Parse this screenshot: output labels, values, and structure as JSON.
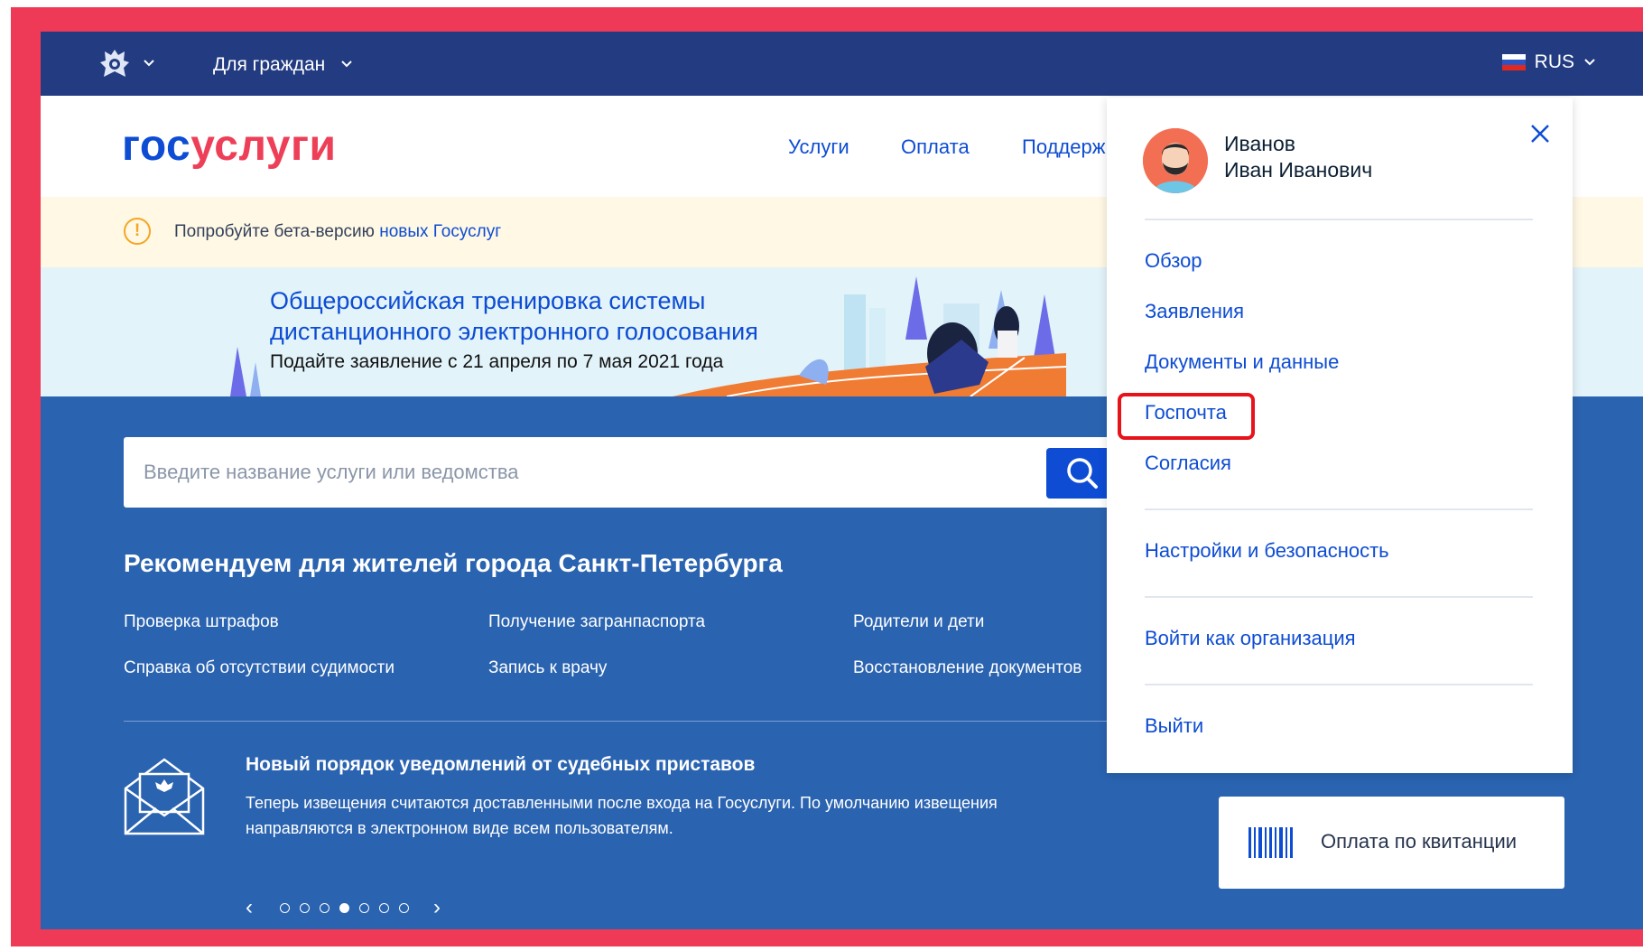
{
  "topbar": {
    "for_citizens": "Для граждан",
    "language": "RUS"
  },
  "header": {
    "logo_part1": "гос",
    "logo_part2": "услуги",
    "nav": [
      "Услуги",
      "Оплата",
      "Поддерж"
    ]
  },
  "beta": {
    "text": "Попробуйте бета-версию ",
    "link": "новых Госуслуг"
  },
  "banner": {
    "title_line1": "Общероссийская тренировка системы",
    "title_line2": "дистанционного  электронного голосования",
    "subtitle": "Подайте заявление с 21 апреля по 7 мая 2021 года"
  },
  "search": {
    "placeholder": "Введите название услуги или ведомства"
  },
  "recommend": {
    "title": "Рекомендуем для жителей города Санкт-Петербурга",
    "links": [
      "Проверка штрафов",
      "Получение загранпаспорта",
      "Родители и дети",
      "Справка об отсутствии судимости",
      "Запись к врачу",
      "Восстановление документов"
    ]
  },
  "news": {
    "title": "Новый порядок уведомлений от судебных приставов",
    "text": "Теперь извещения считаются доставленными после входа на Госуслуги. По умолчанию извещения направляются в электронном виде всем пользователям.",
    "prev": "‹",
    "next": "›",
    "slides_total": 7,
    "slide_active": 4
  },
  "payment": {
    "label": "Оплата по квитанции"
  },
  "user_menu": {
    "last_name": "Иванов",
    "first_middle": "Иван Иванович",
    "items": [
      "Обзор",
      "Заявления",
      "Документы и данные",
      "Госпочта",
      "Согласия",
      "Настройки и безопасность",
      "Войти как организация",
      "Выйти"
    ]
  },
  "colors": {
    "topbar": "#233c81",
    "main_blue": "#2a63b0",
    "link_blue": "#0d4cd3",
    "logo_red": "#ee3f58",
    "frame_red": "#ef3a57",
    "highlight_red": "#e7131a"
  }
}
